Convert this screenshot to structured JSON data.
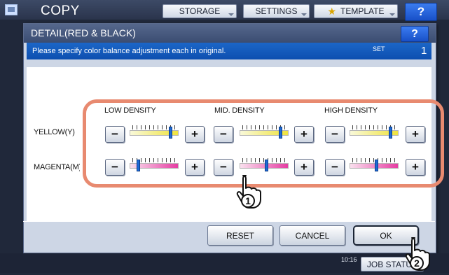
{
  "header": {
    "title": "COPY",
    "storage_label": "STORAGE",
    "settings_label": "SETTINGS",
    "template_label": "TEMPLATE",
    "help_label": "?"
  },
  "dialog": {
    "title": "DETAIL(RED & BLACK)",
    "help_label": "?",
    "instruction": "Please specify color balance adjustment each in original.",
    "set_label": "SET",
    "set_value": "1"
  },
  "columns": [
    "LOW DENSITY",
    "MID. DENSITY",
    "HIGH DENSITY"
  ],
  "rows": [
    {
      "label": "YELLOW(Y)",
      "color": "yellow",
      "levels": [
        8,
        8,
        8
      ],
      "max": 9
    },
    {
      "label": "MAGENTA(M)",
      "color": "magenta",
      "levels": [
        1,
        5,
        5
      ],
      "max": 9
    }
  ],
  "buttons": {
    "minus": "−",
    "plus": "+",
    "reset": "RESET",
    "cancel": "CANCEL",
    "ok": "OK"
  },
  "status": {
    "time": "10:16",
    "job_label": "JOB STATUS"
  },
  "callouts": [
    "1",
    "2"
  ],
  "colors": {
    "yellow_light": "#f9f9d9",
    "yellow_dark": "#efe33e",
    "magenta_light": "#fae0ee",
    "magenta_dark": "#e63da3",
    "highlight": "#e88a70",
    "accent_blue": "#1c66c8"
  }
}
